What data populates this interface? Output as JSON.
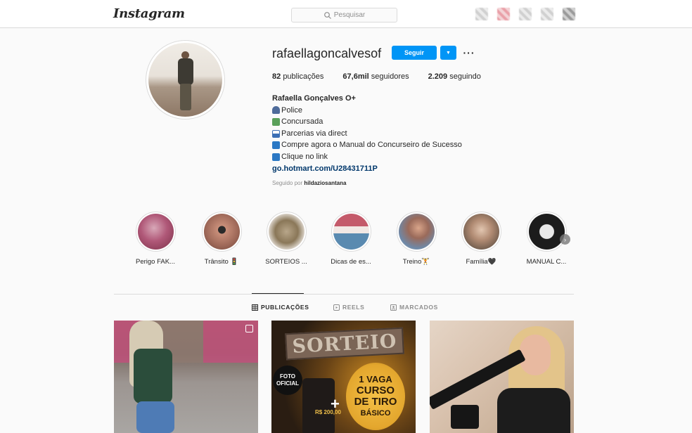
{
  "nav": {
    "logo": "Instagram",
    "search_placeholder": "Pesquisar",
    "icons": [
      "home-icon",
      "direct-icon",
      "explore-icon",
      "activity-icon",
      "profile-icon"
    ]
  },
  "profile": {
    "username": "rafaellagoncalvesof",
    "follow_label": "Seguir",
    "stats": {
      "posts_count": "82",
      "posts_label": "publicações",
      "followers_count": "67,6mil",
      "followers_label": "seguidores",
      "following_count": "2.209",
      "following_label": "seguindo"
    },
    "bio": {
      "name": "Rafaella Gonçalves O+",
      "lines": [
        "Police",
        "Concursada",
        "Parcerias via direct",
        "Compre agora o Manual do Concurseiro de Sucesso",
        "Clique no link"
      ],
      "link": "go.hotmart.com/U28431711P"
    },
    "followed_by_prefix": "Seguido por",
    "followed_by_user": "hildaziosantana"
  },
  "highlights": [
    {
      "label": "Perigo FAK..."
    },
    {
      "label": "Trânsito 🚦"
    },
    {
      "label": "SORTEIOS ..."
    },
    {
      "label": "Dicas de es..."
    },
    {
      "label": "Treino🏋"
    },
    {
      "label": "Família🖤"
    },
    {
      "label": "MANUAL C..."
    }
  ],
  "tabs": [
    {
      "label": "PUBLICAÇÕES",
      "active": true
    },
    {
      "label": "REELS",
      "active": false
    },
    {
      "label": "MARCADOS",
      "active": false
    }
  ],
  "posts": {
    "post2": {
      "sign": "SORTEIO",
      "badge": "FOTO OFICIAL",
      "price": "R$ 200,00",
      "vaga": "1 VAGA",
      "curso": "CURSO",
      "detiro": "DE TIRO",
      "basico": "BÁSICO",
      "plus": "+"
    }
  },
  "colors": {
    "primary_button": "#0095f6",
    "link": "#00376b",
    "background": "#fafafa",
    "border": "#dbdbdb",
    "muted_text": "#8e8e8e"
  }
}
